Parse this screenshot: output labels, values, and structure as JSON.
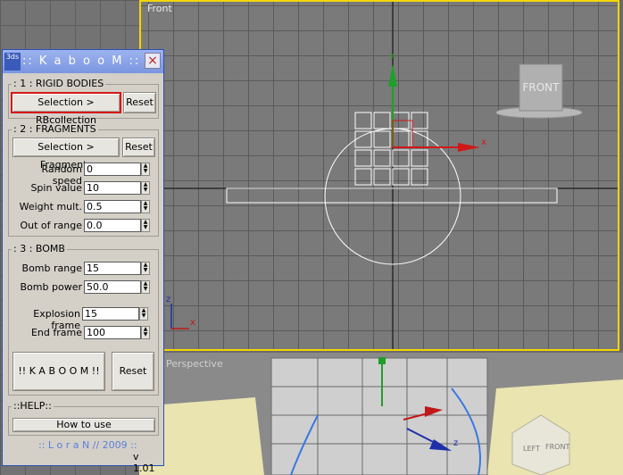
{
  "viewports": {
    "front_label": "Front",
    "perspective_label": "Perspective",
    "viewcube_front_label": "FRONT",
    "viewcube_left_label": "LEFT",
    "viewcube_front_small": "FRONT",
    "axis_x": "x",
    "axis_y": "y",
    "axis_z": "z"
  },
  "dialog": {
    "icon_text": "3ds",
    "title": ":: K a b o o M ::",
    "close_symbol": "×",
    "rigid_bodies": {
      "title": ": 1 : RIGID BODIES",
      "selection_button": "Selection > RBcollection",
      "reset_button": "Reset"
    },
    "fragments": {
      "title": ": 2 : FRAGMENTS",
      "selection_button": "Selection > Fragments",
      "reset_button": "Reset",
      "fields": [
        {
          "label": "Random speed",
          "value": "0"
        },
        {
          "label": "Spin value",
          "value": "10"
        },
        {
          "label": "Weight mult.",
          "value": "0.5"
        },
        {
          "label": "Out of range",
          "value": "0.0"
        }
      ]
    },
    "bomb": {
      "title": ": 3 : BOMB",
      "fields": [
        {
          "label": "Bomb range",
          "value": "15"
        },
        {
          "label": "Bomb power",
          "value": "50.0"
        },
        {
          "label": "Explosion frame",
          "value": "15"
        },
        {
          "label": "End frame",
          "value": "100"
        }
      ],
      "kaboom_button": "!! K A B O O M !!",
      "reset_button": "Reset"
    },
    "help": {
      "title": "::HELP::",
      "how_to_button": "How to use"
    },
    "credit": ":: L o r a N // 2009 ::",
    "version": "v 1.01"
  }
}
